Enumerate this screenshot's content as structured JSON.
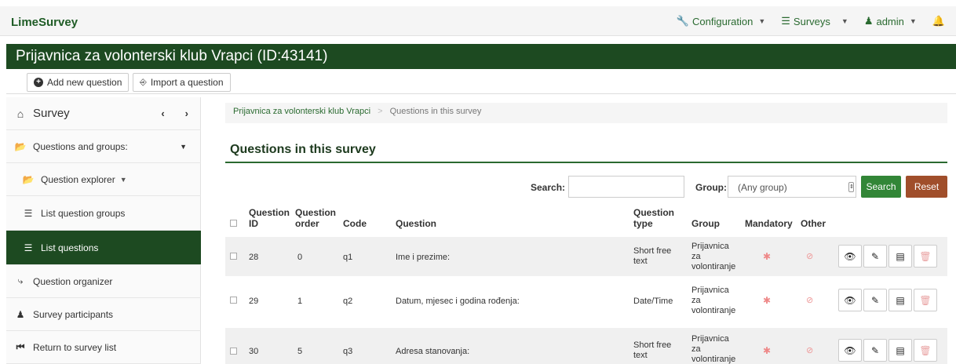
{
  "app": {
    "brand": "LimeSurvey",
    "nav": {
      "configuration": "Configuration",
      "surveys": "Surveys",
      "admin": "admin"
    }
  },
  "survey_title": "Prijavnica za volonterski klub Vrapci (ID:43141)",
  "toolbar": {
    "add_question": "Add new question",
    "import_question": "Import a question"
  },
  "sidebar": {
    "survey": "Survey",
    "items": [
      {
        "label": "Questions and groups:",
        "icon": "folder-open-icon"
      },
      {
        "label": "Question explorer",
        "icon": "folder-open-icon"
      },
      {
        "label": "List question groups",
        "icon": "list-icon"
      },
      {
        "label": "List questions",
        "icon": "list-icon"
      },
      {
        "label": "Question organizer",
        "icon": "organizer-icon"
      },
      {
        "label": "Survey participants",
        "icon": "user-icon"
      },
      {
        "label": "Return to survey list",
        "icon": "back-icon"
      }
    ]
  },
  "breadcrumb": {
    "survey": "Prijavnica za volonterski klub Vrapci",
    "current": "Questions in this survey"
  },
  "page_title": "Questions in this survey",
  "filters": {
    "search_label": "Search:",
    "search_value": "",
    "group_label": "Group:",
    "group_value": "(Any group)",
    "search_button": "Search",
    "reset_button": "Reset"
  },
  "table": {
    "headers": {
      "qid_1": "Question",
      "qid_2": "ID",
      "order_1": "Question",
      "order_2": "order",
      "code": "Code",
      "question": "Question",
      "type_1": "Question",
      "type_2": "type",
      "group": "Group",
      "mandatory": "Mandatory",
      "other": "Other"
    },
    "rows": [
      {
        "id": "28",
        "order": "0",
        "code": "q1",
        "question": "Ime i prezime:",
        "type_1": "Short free",
        "type_2": "text",
        "group_1": "Prijavnica",
        "group_2": "za",
        "group_3": "volontiranje",
        "mandatory": "✱",
        "other": "⊘"
      },
      {
        "id": "29",
        "order": "1",
        "code": "q2",
        "question": "Datum, mjesec i godina rođenja:",
        "type_1": "Date/Time",
        "type_2": "",
        "group_1": "Prijavnica",
        "group_2": "za",
        "group_3": "volontiranje",
        "mandatory": "✱",
        "other": "⊘"
      },
      {
        "id": "30",
        "order": "5",
        "code": "q3",
        "question": "Adresa stanovanja:",
        "type_1": "Short free",
        "type_2": "text",
        "group_1": "Prijavnica",
        "group_2": "za",
        "group_3": "volontiranje",
        "mandatory": "✱",
        "other": "⊘"
      }
    ]
  }
}
